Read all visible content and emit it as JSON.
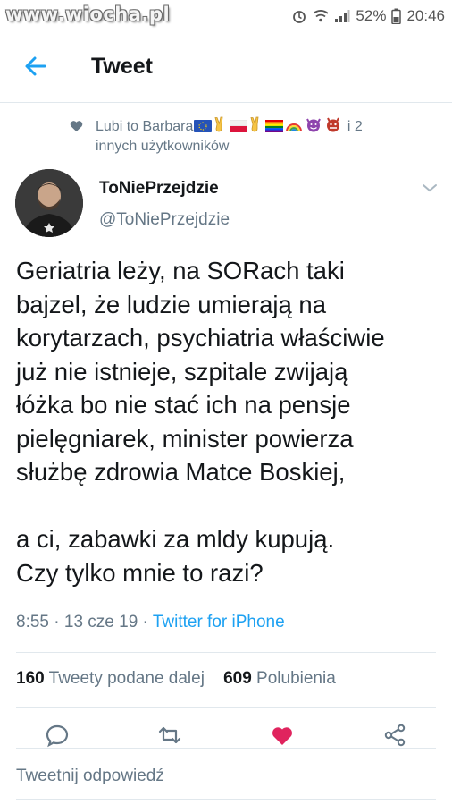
{
  "watermark": "www.wiocha.pl",
  "status": {
    "battery": "52%",
    "time": "20:46"
  },
  "header": {
    "title": "Tweet"
  },
  "social_context": {
    "prefix": "Lubi to Barbara",
    "suffix_line1": " i 2",
    "line2": "innych użytkowników"
  },
  "author": {
    "name": "ToNiePrzejdzie",
    "handle": "@ToNiePrzejdzie"
  },
  "tweet": {
    "text": "Geriatria leży, na SORach taki\nbajzel, że ludzie umierają na\nkorytarzach, psychiatria właściwie\njuż nie istnieje, szpitale zwijają\nłóżka bo nie stać ich na pensje\npielęgniarek, minister powierza\nsłużbę zdrowia Matce Boskiej,\n\na ci, zabawki za mldy kupują.\nCzy tylko mnie to razi?"
  },
  "meta": {
    "time": "8:55",
    "sep1": " · ",
    "date": "13 cze 19",
    "sep2": " · ",
    "source": "Twitter for iPhone"
  },
  "stats": {
    "retweets_count": "160",
    "retweets_label": "Tweety podane dalej",
    "likes_count": "609",
    "likes_label": "Polubienia"
  },
  "actions": [
    "reply-icon",
    "retweet-icon",
    "like-icon",
    "share-icon"
  ],
  "colors": {
    "accent": "#1da1f2",
    "like": "#e0245e",
    "muted": "#657786"
  },
  "reply_placeholder": "Tweetnij odpowiedź"
}
